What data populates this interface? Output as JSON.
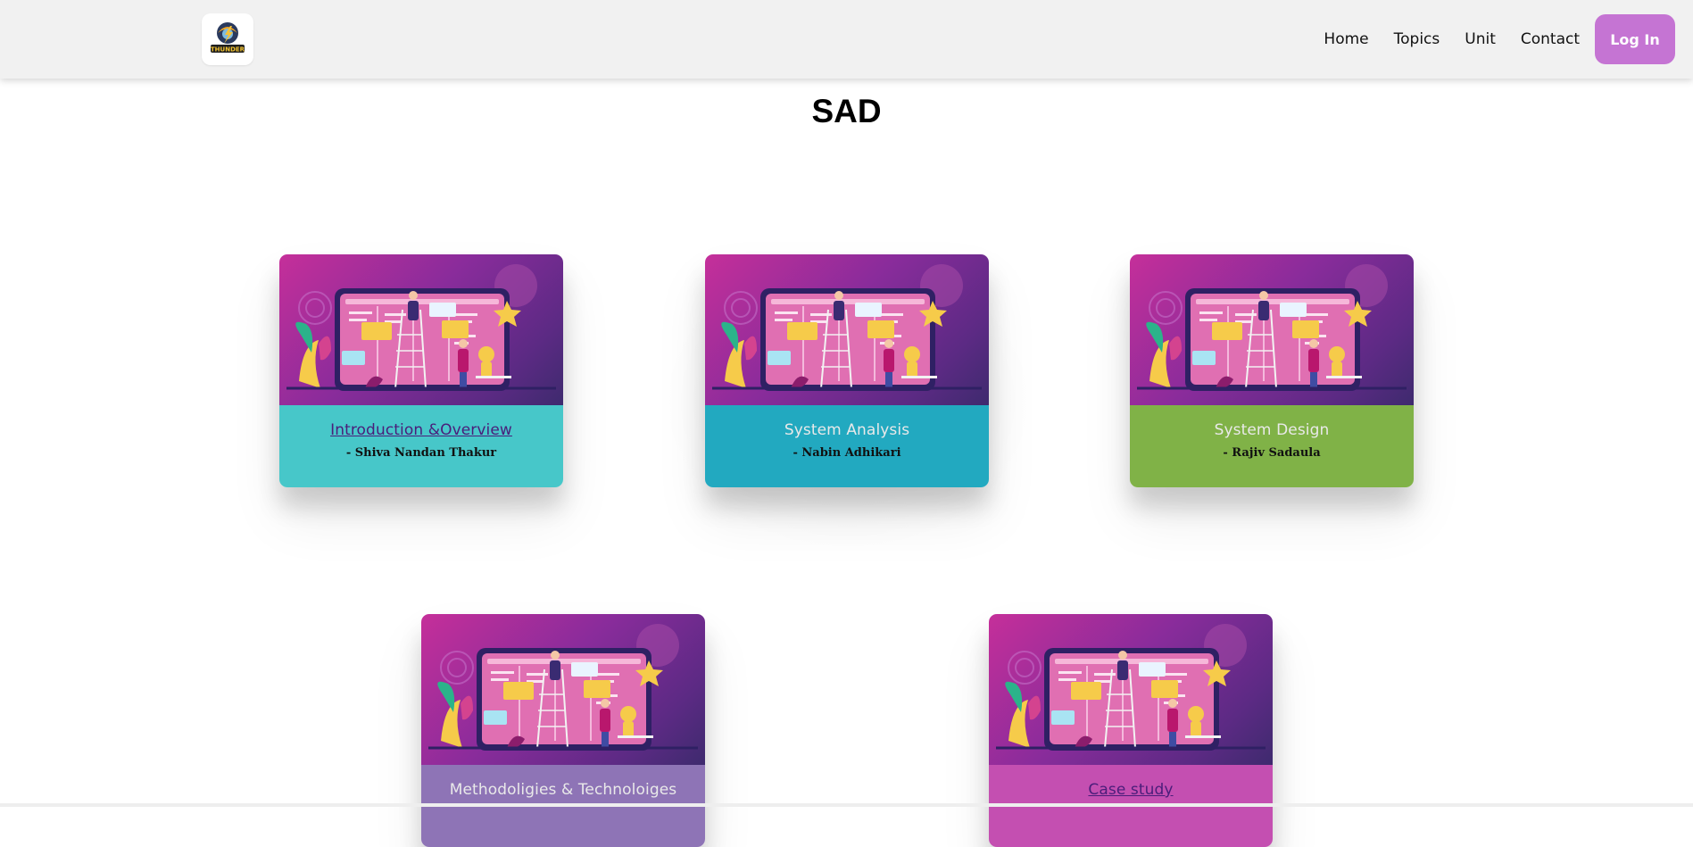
{
  "header": {
    "logo_icon": "thunder-logo-icon",
    "logo_text": "THUNDER",
    "nav": [
      {
        "label": "Home"
      },
      {
        "label": "Topics"
      },
      {
        "label": "Unit"
      },
      {
        "label": "Contact"
      }
    ],
    "login_label": "Log In",
    "login_color": "#c574d3"
  },
  "page": {
    "title": "SAD"
  },
  "cards": [
    {
      "topic": "Introduction &Overview",
      "author": "- Shiva Nandan Thakur",
      "color": "#47c7c9",
      "icon": "team-kanban-illustration-icon"
    },
    {
      "topic": "System Analysis",
      "author": "- Nabin Adhikari",
      "color": "#22a9c0",
      "icon": "team-kanban-illustration-icon"
    },
    {
      "topic": "System Design",
      "author": "- Rajiv Sadaula",
      "color": "#80b247",
      "icon": "team-kanban-illustration-icon"
    },
    {
      "topic": "Methodoligies & Technoloiges",
      "author": "",
      "color": "#8e74b6",
      "icon": "team-kanban-illustration-icon"
    },
    {
      "topic": "Case study",
      "author": "",
      "color": "#c44fb1",
      "icon": "team-kanban-illustration-icon"
    }
  ]
}
